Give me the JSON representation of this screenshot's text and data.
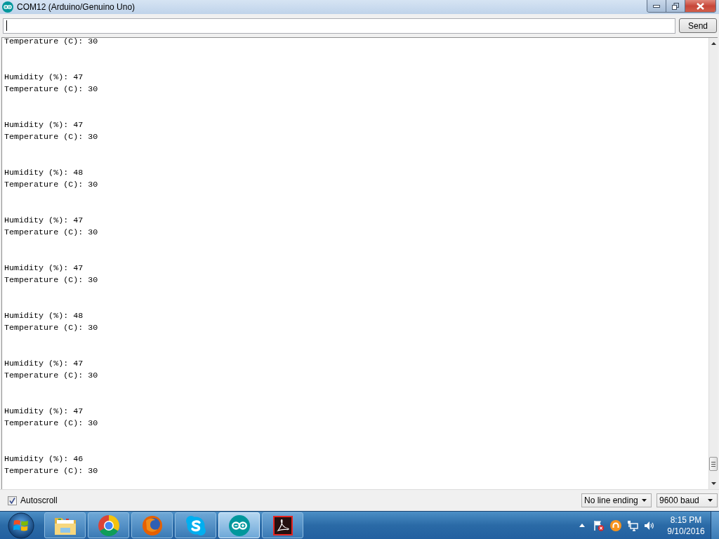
{
  "window": {
    "title": "COM12 (Arduino/Genuino Uno)"
  },
  "send_bar": {
    "field": {
      "focused": true
    },
    "button": "Send"
  },
  "serial_output": [
    [
      "Temperature (C): 30"
    ],
    [
      "Humidity (%): 47",
      "Temperature (C): 30"
    ],
    [
      "Humidity (%): 47",
      "Temperature (C): 30"
    ],
    [
      "Humidity (%): 48",
      "Temperature (C): 30"
    ],
    [
      "Humidity (%): 47",
      "Temperature (C): 30"
    ],
    [
      "Humidity (%): 47",
      "Temperature (C): 30"
    ],
    [
      "Humidity (%): 48",
      "Temperature (C): 30"
    ],
    [
      "Humidity (%): 47",
      "Temperature (C): 30"
    ],
    [
      "Humidity (%): 47",
      "Temperature (C): 30"
    ],
    [
      "Humidity (%): 46",
      "Temperature (C): 30"
    ]
  ],
  "bottom_bar": {
    "autoscroll": {
      "label": "Autoscroll",
      "checked": true
    },
    "line_ending": "No line ending",
    "baud_rate": "9600 baud"
  },
  "taskbar": {
    "apps": [
      {
        "kind": "files",
        "selected": false
      },
      {
        "kind": "ring",
        "selected": false
      },
      {
        "kind": "fox",
        "selected": false
      },
      {
        "kind": "chat",
        "selected": false
      },
      {
        "kind": "infinity",
        "selected": true
      },
      {
        "kind": "document",
        "selected": false
      }
    ],
    "clock": {
      "time": "8:15 PM",
      "date": "9/10/2016"
    }
  }
}
